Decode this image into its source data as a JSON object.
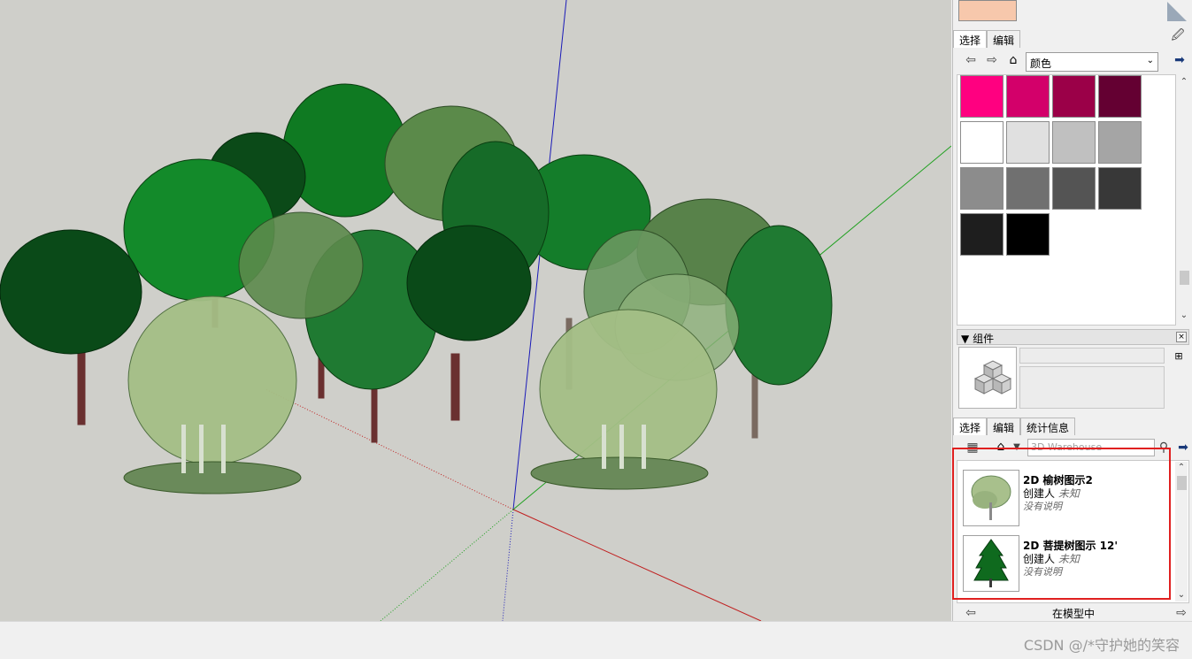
{
  "materials": {
    "tabs": [
      "选择",
      "编辑"
    ],
    "dropdown_value": "颜色",
    "icons": [
      "back-arrow",
      "forward-arrow",
      "home",
      "eyedropper",
      "details-arrow"
    ],
    "swatches": [
      "#ff0080",
      "#d3006a",
      "#9b0048",
      "#640032",
      "#ffffff",
      "#e0e0e0",
      "#c0c0c0",
      "#a5a5a5",
      "#8c8c8c",
      "#707070",
      "#545454",
      "#383838",
      "#1e1e1e",
      "#000000"
    ],
    "top_swatch_color": "#f7c8ac"
  },
  "components": {
    "header": "组件",
    "tabs": [
      "选择",
      "编辑",
      "统计信息"
    ],
    "search_placeholder": "3D Warehouse",
    "items": [
      {
        "title": "2D 榆树图示2",
        "author_label": "创建人",
        "author": "未知",
        "description": "没有说明"
      },
      {
        "title": "2D 菩提树图示 12'",
        "author_label": "创建人",
        "author": "未知",
        "description": "没有说明"
      }
    ],
    "footer": "在模型中"
  },
  "watermark": "CSDN @/*守护她的笑容"
}
